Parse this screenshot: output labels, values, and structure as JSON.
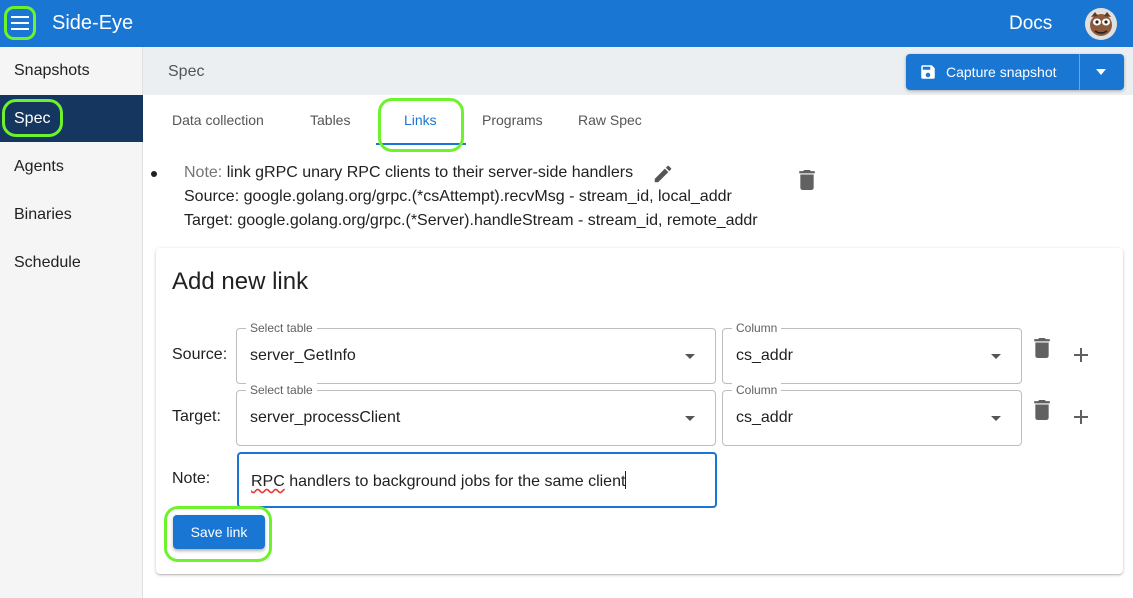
{
  "app": {
    "title": "Side-Eye",
    "docs_label": "Docs"
  },
  "sidebar": {
    "items": [
      {
        "label": "Snapshots"
      },
      {
        "label": "Spec"
      },
      {
        "label": "Agents"
      },
      {
        "label": "Binaries"
      },
      {
        "label": "Schedule"
      }
    ],
    "active_index": 1
  },
  "header": {
    "breadcrumb": "Spec",
    "capture_label": "Capture snapshot"
  },
  "tabs": [
    {
      "label": "Data collection"
    },
    {
      "label": "Tables"
    },
    {
      "label": "Links"
    },
    {
      "label": "Programs"
    },
    {
      "label": "Raw Spec"
    }
  ],
  "active_tab": "Links",
  "existing_link": {
    "note_label": "Note:",
    "note_text": "link gRPC unary RPC clients to their server-side handlers",
    "source_line": "Source: google.golang.org/grpc.(*csAttempt).recvMsg - stream_id, local_addr",
    "target_line": "Target: google.golang.org/grpc.(*Server).handleStream - stream_id, remote_addr"
  },
  "form": {
    "title": "Add new link",
    "source_label": "Source:",
    "target_label": "Target:",
    "note_label": "Note:",
    "select_table_label": "Select table",
    "column_label": "Column",
    "source_table": "server_GetInfo",
    "source_column": "cs_addr",
    "target_table": "server_processClient",
    "target_column": "cs_addr",
    "note_value_squiggle": "RPC",
    "note_value_rest": " handlers to background jobs for the same client",
    "save_label": "Save link"
  },
  "colors": {
    "primary": "#1976d2",
    "active_nav": "#15365e",
    "highlight": "#6ef22b"
  }
}
